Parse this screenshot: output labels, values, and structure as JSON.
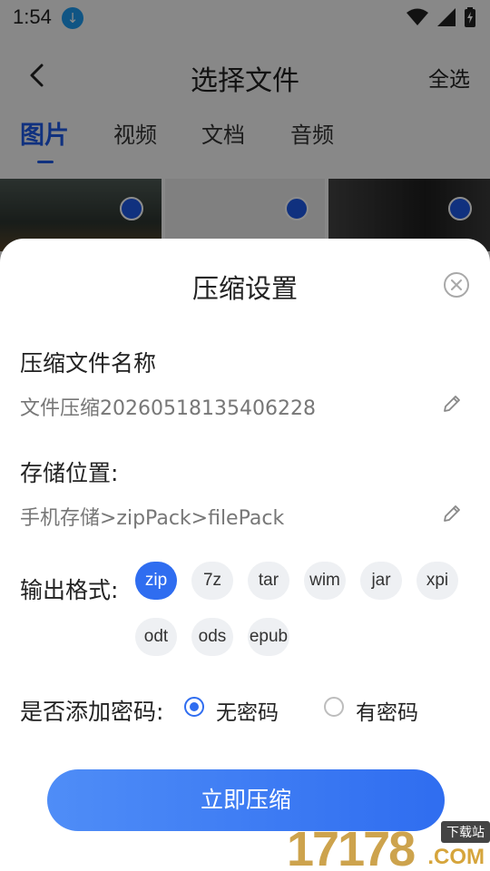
{
  "status_bar": {
    "time": "1:54"
  },
  "header": {
    "title": "选择文件",
    "select_all": "全选"
  },
  "tabs": [
    {
      "label": "图片",
      "active": true
    },
    {
      "label": "视频",
      "active": false
    },
    {
      "label": "文档",
      "active": false
    },
    {
      "label": "音频",
      "active": false
    }
  ],
  "sheet": {
    "title": "压缩设置",
    "file_name_label": "压缩文件名称",
    "file_name_value": "文件压缩20260518135406228",
    "storage_label": "存储位置:",
    "storage_value": "手机存储>zipPack>filePack",
    "format_label": "输出格式:",
    "formats": [
      "zip",
      "7z",
      "tar",
      "wim",
      "jar",
      "xpi",
      "odt",
      "ods",
      "epub"
    ],
    "selected_format": "zip",
    "password_label": "是否添加密码:",
    "password_options": [
      "无密码",
      "有密码"
    ],
    "selected_password_option": "无密码",
    "submit_label": "立即压缩"
  },
  "watermark": {
    "number": "17178",
    "tag": "下载站",
    "suffix": ".COM"
  },
  "colors": {
    "accent": "#2f6df0",
    "tab_active": "#1e5ae8"
  }
}
